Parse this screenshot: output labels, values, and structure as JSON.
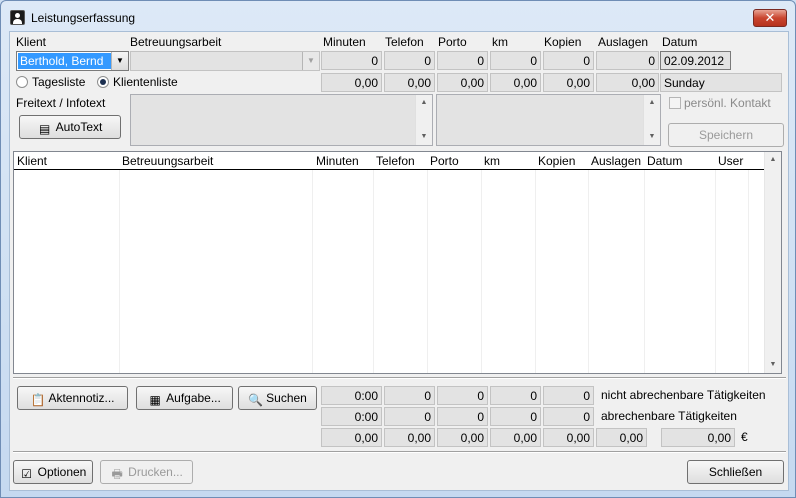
{
  "window": {
    "title": "Leistungserfassung",
    "close_symbol": "✕"
  },
  "labels": {
    "klient": "Klient",
    "betreuungsarbeit": "Betreuungsarbeit",
    "minuten": "Minuten",
    "telefon": "Telefon",
    "porto": "Porto",
    "km": "km",
    "kopien": "Kopien",
    "auslagen": "Auslagen",
    "datum": "Datum",
    "freitext": "Freitext / Infotext"
  },
  "entry": {
    "klient_value": "Berthold, Bernd",
    "betreuungsarbeit_value": "",
    "minuten": "0",
    "telefon": "0",
    "porto": "0",
    "km": "0",
    "kopien": "0",
    "auslagen": "0",
    "datum": "02.09.2012",
    "weekday": "Sunday"
  },
  "totals_row": [
    "0,00",
    "0,00",
    "0,00",
    "0,00",
    "0,00",
    "0,00"
  ],
  "radio": {
    "tagesliste": "Tagesliste",
    "klientenliste": "Klientenliste",
    "selected": "klientenliste"
  },
  "buttons": {
    "autotext": "AutoText",
    "speichern": "Speichern",
    "aktennotiz": "Aktennotiz...",
    "aufgabe": "Aufgabe...",
    "suchen": "Suchen",
    "optionen": "Optionen",
    "drucken": "Drucken...",
    "schliessen": "Schließen"
  },
  "checkbox": {
    "persoenl_kontakt": "persönl. Kontakt",
    "checked": false
  },
  "grid": {
    "columns": [
      "Klient",
      "Betreuungsarbeit",
      "Minuten",
      "Telefon",
      "Porto",
      "km",
      "Kopien",
      "Auslagen",
      "Datum",
      "User"
    ],
    "rows": []
  },
  "summary": {
    "nicht_abrechenbar": {
      "label": "nicht abrechenbare Tätigkeiten",
      "values": [
        "0:00",
        "0",
        "0",
        "0",
        "0"
      ]
    },
    "abrechenbar": {
      "label": "abrechenbare Tätigkeiten",
      "values": [
        "0:00",
        "0",
        "0",
        "0",
        "0"
      ]
    },
    "sum_row": [
      "0,00",
      "0,00",
      "0,00",
      "0,00",
      "0,00",
      "0,00"
    ],
    "total": "0,00",
    "currency": "€"
  }
}
